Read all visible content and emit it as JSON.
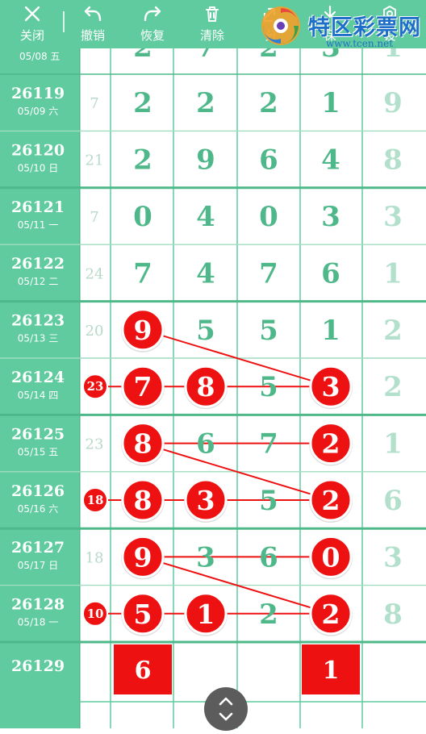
{
  "toolbar": {
    "close": "关闭",
    "undo": "撤销",
    "redo": "恢复",
    "clear": "清除",
    "share": "分",
    "save": "保",
    "settings": "设"
  },
  "logo": {
    "name": "特区彩票网",
    "url": "www.tcen.net"
  },
  "partial_top_row": {
    "date": "05/08 五",
    "sum": "",
    "digits": [
      "2",
      "7",
      "2",
      "3"
    ],
    "last": "1"
  },
  "rows": [
    {
      "issue": "26119",
      "date": "05/09 六",
      "sum": "7",
      "digits": [
        "2",
        "2",
        "2",
        "1"
      ],
      "last": "9",
      "hits": [],
      "hit_sum": ""
    },
    {
      "issue": "26120",
      "date": "05/10 日",
      "sum": "21",
      "digits": [
        "2",
        "9",
        "6",
        "4"
      ],
      "last": "8",
      "hits": [],
      "hit_sum": ""
    },
    {
      "issue": "26121",
      "date": "05/11 一",
      "sum": "7",
      "digits": [
        "0",
        "4",
        "0",
        "3"
      ],
      "last": "3",
      "hits": [],
      "hit_sum": ""
    },
    {
      "issue": "26122",
      "date": "05/12 二",
      "sum": "24",
      "digits": [
        "7",
        "4",
        "7",
        "6"
      ],
      "last": "1",
      "hits": [],
      "hit_sum": ""
    },
    {
      "issue": "26123",
      "date": "05/13 三",
      "sum": "20",
      "digits": [
        "9",
        "5",
        "5",
        "1"
      ],
      "last": "2",
      "hits": [
        0
      ],
      "hit_sum": ""
    },
    {
      "issue": "26124",
      "date": "05/14 四",
      "sum": "",
      "digits": [
        "7",
        "8",
        "5",
        "3"
      ],
      "last": "2",
      "hits": [
        0,
        1,
        3
      ],
      "hit_sum": "23"
    },
    {
      "issue": "26125",
      "date": "05/15 五",
      "sum": "23",
      "digits": [
        "8",
        "6",
        "7",
        "2"
      ],
      "last": "1",
      "hits": [
        0,
        3
      ],
      "hit_sum": ""
    },
    {
      "issue": "26126",
      "date": "05/16 六",
      "sum": "",
      "digits": [
        "8",
        "3",
        "5",
        "2"
      ],
      "last": "6",
      "hits": [
        0,
        1,
        3
      ],
      "hit_sum": "18"
    },
    {
      "issue": "26127",
      "date": "05/17 日",
      "sum": "18",
      "digits": [
        "9",
        "3",
        "6",
        "0"
      ],
      "last": "3",
      "hits": [
        0,
        3
      ],
      "hit_sum": ""
    },
    {
      "issue": "26128",
      "date": "05/18 一",
      "sum": "",
      "digits": [
        "5",
        "1",
        "2",
        "2"
      ],
      "last": "8",
      "hits": [
        0,
        1,
        3
      ],
      "hit_sum": "10"
    }
  ],
  "prediction_row": {
    "issue": "26129",
    "digits": [
      "6",
      "",
      "",
      "1"
    ]
  },
  "colors": {
    "green": "#5fcb9e",
    "red": "#ee1111",
    "digit": "#4fb88a"
  }
}
